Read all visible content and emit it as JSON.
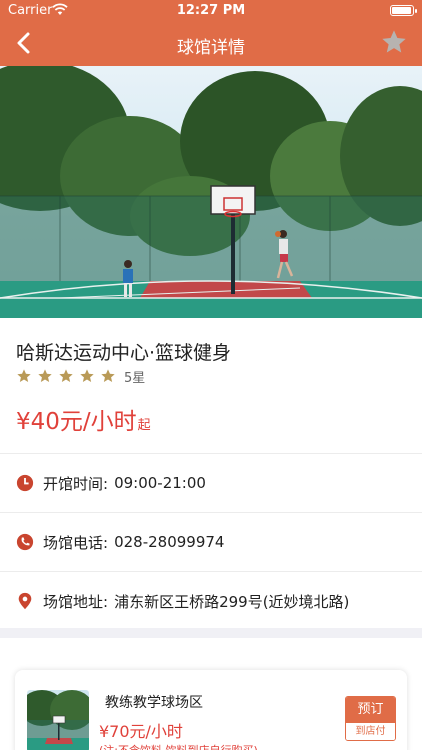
{
  "status_bar": {
    "carrier": "Carrier",
    "time": "12:27 PM"
  },
  "nav": {
    "title": "球馆详情",
    "back_icon": "chevron-left-icon",
    "favorite_icon": "star-icon"
  },
  "venue": {
    "name": "哈斯达运动中心·篮球健身",
    "rating_stars": 5,
    "rating_text": "5星",
    "price": "¥40元/小时",
    "price_suffix": "起"
  },
  "info": [
    {
      "icon": "clock-icon",
      "label": "开馆时间:",
      "value": "09:00-21:00"
    },
    {
      "icon": "phone-icon",
      "label": "场馆电话:",
      "value": "028-28099974"
    },
    {
      "icon": "location-pin-icon",
      "label": "场馆地址:",
      "value": "浦东新区王桥路299号(近妙境北路)"
    }
  ],
  "court": {
    "name": "教练教学球场区",
    "price": "¥70元/小时",
    "note": "(注:不含饮料,饮料到店自行购买)",
    "book_label": "预订",
    "pay_label": "到店付"
  },
  "colors": {
    "accent": "#e06c47",
    "price": "#e0413a",
    "star": "#b99a57"
  }
}
